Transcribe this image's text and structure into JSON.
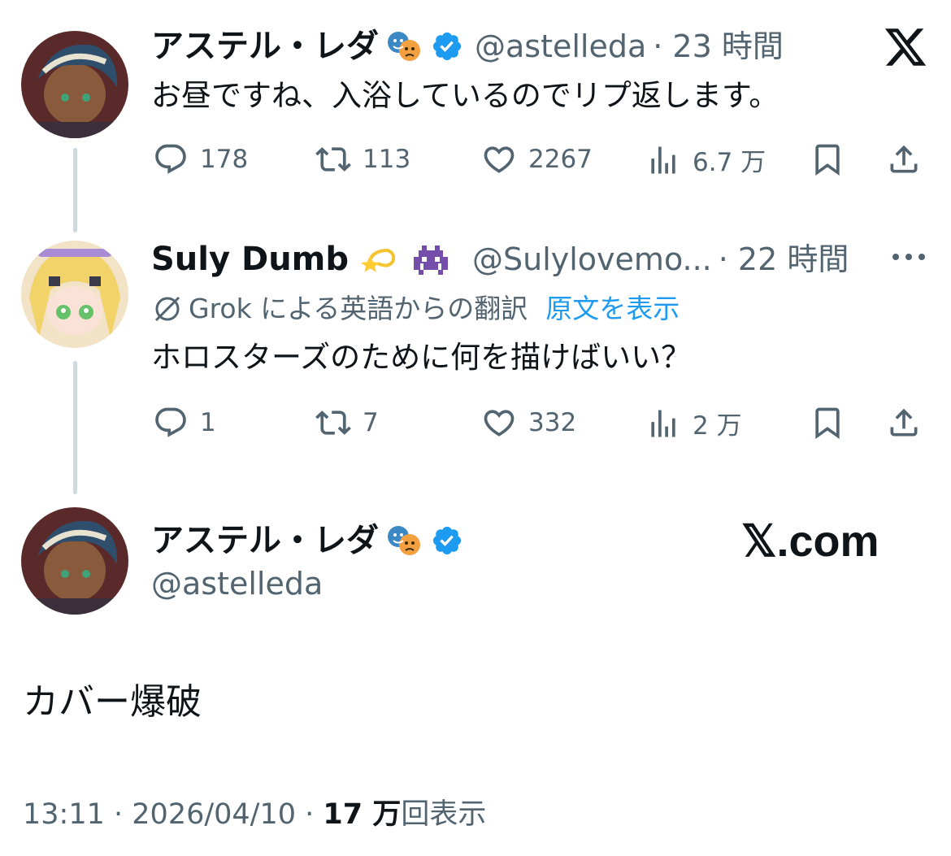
{
  "tweet1": {
    "name": "アステル・レダ",
    "handle": "@astelleda",
    "time": "· 23 時間",
    "text": "お昼ですね、入浴しているのでリプ返します。",
    "replies": "178",
    "retweets": "113",
    "likes": "2267",
    "views": "6.7 万"
  },
  "tweet2": {
    "name": "Suly Dumb",
    "handle": "@Sulylovemo...",
    "time": "· 22 時間",
    "translated_by": "Grok による英語からの翻訳",
    "show_original": "原文を表示",
    "text": "ホロスターズのために何を描けばいい？",
    "replies": "1",
    "retweets": "7",
    "likes": "332",
    "views": "2 万"
  },
  "main_tweet": {
    "name": "アステル・レダ",
    "handle": "@astelleda",
    "text": "カバー爆破",
    "time": "13:11",
    "date": "2026/04/10",
    "views_count": "17 万",
    "views_label": "回表示"
  },
  "branding": {
    "logo_text": "𝕏",
    "site": "𝕏.com"
  },
  "colors": {
    "text": "#0f1419",
    "secondary": "#536471",
    "accent": "#1d9bf0",
    "thread_line": "#cfd9de"
  },
  "icons": [
    "reply-icon",
    "retweet-icon",
    "like-icon",
    "views-icon",
    "bookmark-icon",
    "share-icon",
    "verified-badge-icon",
    "more-icon",
    "grok-icon",
    "x-logo-icon"
  ]
}
